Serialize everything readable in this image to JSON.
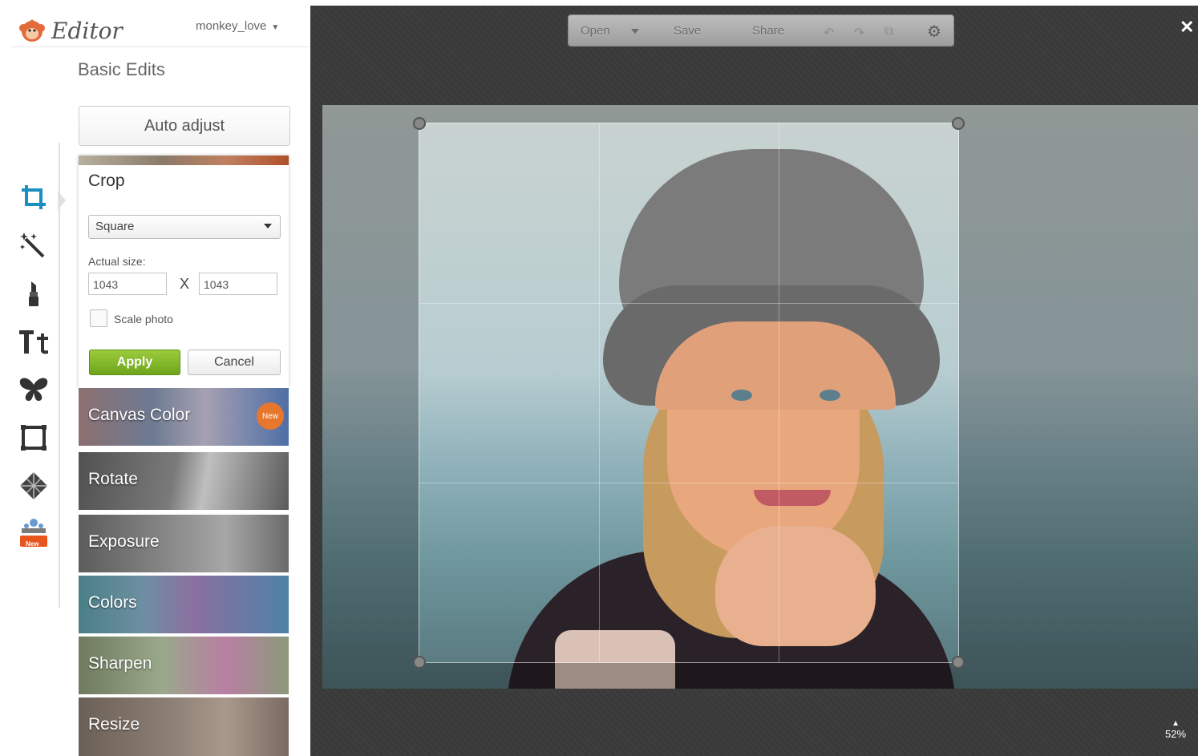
{
  "app": {
    "logo_text": "Editor",
    "username": "monkey_love"
  },
  "sidebar": {
    "section_title": "Basic Edits",
    "auto_adjust_label": "Auto adjust",
    "tools": [
      "crop-icon",
      "magic-wand-icon",
      "lipstick-icon",
      "text-icon",
      "butterfly-icon",
      "frame-icon",
      "texture-icon",
      "seasonal-icon"
    ],
    "seasonal_badge": "New"
  },
  "crop": {
    "title": "Crop",
    "preset": "Square",
    "actual_size_label": "Actual size:",
    "width": "1043",
    "height": "1043",
    "separator": "X",
    "scale_label": "Scale photo",
    "apply_label": "Apply",
    "cancel_label": "Cancel"
  },
  "tiles": [
    {
      "label": "Canvas Color",
      "badge": "New"
    },
    {
      "label": "Rotate"
    },
    {
      "label": "Exposure"
    },
    {
      "label": "Colors"
    },
    {
      "label": "Sharpen"
    },
    {
      "label": "Resize"
    }
  ],
  "toolbar": {
    "open": "Open",
    "save": "Save",
    "share": "Share"
  },
  "canvas": {
    "zoom": "52%"
  },
  "colors": {
    "apply_green": "#7fb527",
    "workspace": "#3a3a3a",
    "accent_orange": "#e8772e",
    "tool_blue": "#1a8fc0"
  }
}
